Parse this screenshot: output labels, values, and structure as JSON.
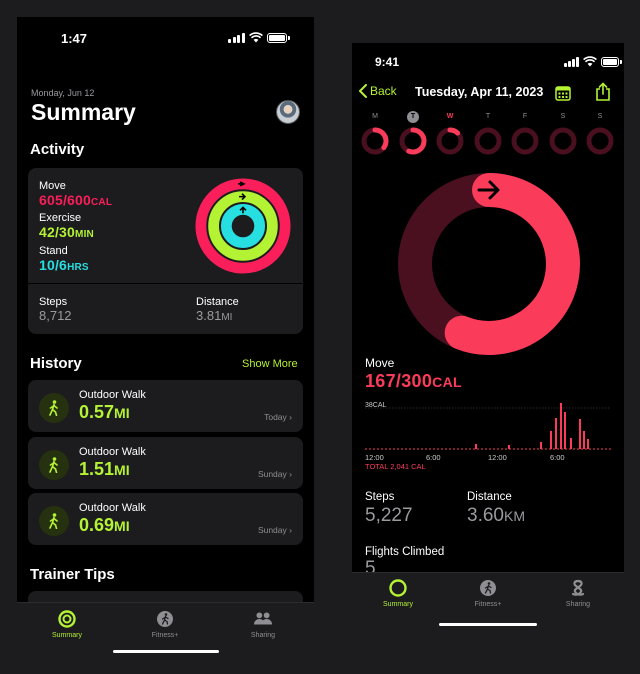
{
  "left": {
    "status": {
      "time": "1:47"
    },
    "header": {
      "date": "Monday, Jun 12",
      "title": "Summary"
    },
    "activity": {
      "section_title": "Activity",
      "move": {
        "label": "Move",
        "value": "605/600",
        "unit": "CAL",
        "color": "#fa1e5a"
      },
      "exercise": {
        "label": "Exercise",
        "value": "42/30",
        "unit": "MIN",
        "color": "#b4f234"
      },
      "stand": {
        "label": "Stand",
        "value": "10/6",
        "unit": "HRS",
        "color": "#27dee1"
      },
      "steps": {
        "label": "Steps",
        "value": "8,712"
      },
      "distance": {
        "label": "Distance",
        "value": "3.81",
        "unit": "MI"
      }
    },
    "history": {
      "section_title": "History",
      "show_more": "Show More",
      "items": [
        {
          "title": "Outdoor Walk",
          "value": "0.57",
          "unit": "MI",
          "when": "Today"
        },
        {
          "title": "Outdoor Walk",
          "value": "1.51",
          "unit": "MI",
          "when": "Sunday"
        },
        {
          "title": "Outdoor Walk",
          "value": "0.69",
          "unit": "MI",
          "when": "Sunday"
        }
      ]
    },
    "trainer_tips": {
      "section_title": "Trainer Tips"
    },
    "tabs": [
      {
        "label": "Summary",
        "icon": "summary-icon"
      },
      {
        "label": "Fitness+",
        "icon": "fitness-plus-icon"
      },
      {
        "label": "Sharing",
        "icon": "sharing-icon"
      }
    ]
  },
  "right": {
    "status": {
      "time": "9:41"
    },
    "nav": {
      "back": "Back",
      "title": "Tuesday, Apr 11, 2023"
    },
    "week": [
      {
        "day": "M",
        "progress": 0.35
      },
      {
        "day": "T",
        "progress": 0.56,
        "today": true
      },
      {
        "day": "W",
        "progress": 0.12,
        "highlight": true
      },
      {
        "day": "T",
        "progress": 0
      },
      {
        "day": "F",
        "progress": 0
      },
      {
        "day": "S",
        "progress": 0
      },
      {
        "day": "S",
        "progress": 0
      }
    ],
    "move": {
      "label": "Move",
      "value": "167/300",
      "unit": "CAL",
      "progress": 0.56
    },
    "chart": {
      "max_label": "38CAL",
      "x_ticks": [
        "12:00",
        "6:00",
        "12:00",
        "6:00"
      ],
      "total": "TOTAL 2,041 CAL"
    },
    "steps": {
      "label": "Steps",
      "value": "5,227"
    },
    "distance": {
      "label": "Distance",
      "value": "3.60",
      "unit": "KM"
    },
    "flights": {
      "label": "Flights Climbed",
      "value": "5"
    },
    "tabs": [
      {
        "label": "Summary",
        "icon": "summary-icon"
      },
      {
        "label": "Fitness+",
        "icon": "fitness-plus-icon"
      },
      {
        "label": "Sharing",
        "icon": "sharing-icon"
      }
    ]
  },
  "colors": {
    "accent": "#b4f234",
    "move": "#fa1e5a",
    "stand": "#27dee1"
  }
}
